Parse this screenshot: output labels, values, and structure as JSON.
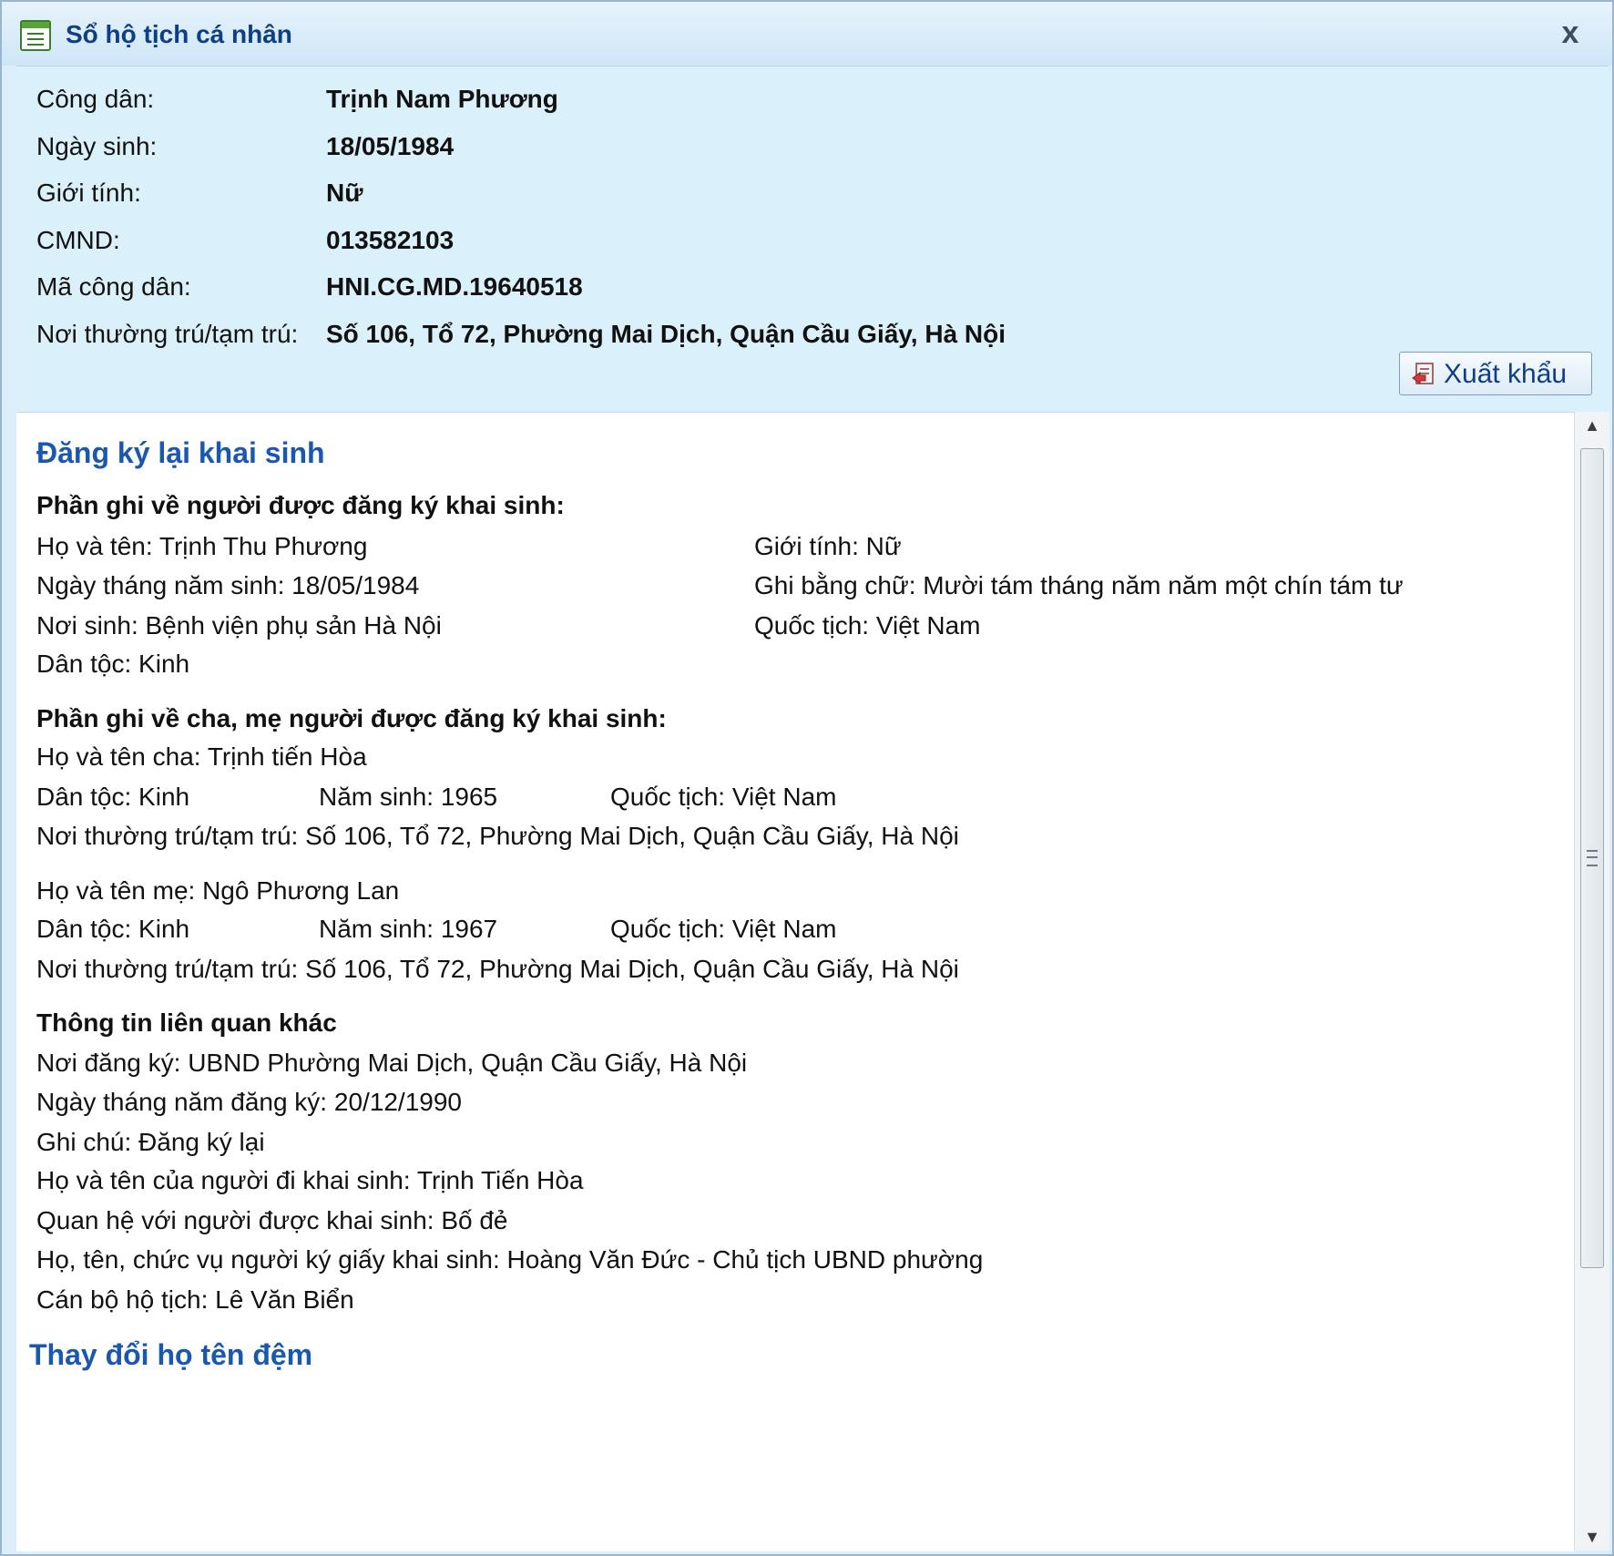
{
  "window": {
    "title": "Sổ hộ tịch cá nhân",
    "close_label": "x"
  },
  "citizen": {
    "fields": [
      {
        "label": "Công dân:",
        "value": "Trịnh Nam Phương"
      },
      {
        "label": "Ngày sinh:",
        "value": "18/05/1984"
      },
      {
        "label": "Giới tính:",
        "value": "Nữ"
      },
      {
        "label": "CMND:",
        "value": "013582103"
      },
      {
        "label": "Mã công dân:",
        "value": "HNI.CG.MD.19640518"
      },
      {
        "label": "Nơi thường trú/tạm trú:",
        "value": "Số 106, Tổ 72, Phường Mai Dịch, Quận Cầu Giấy, Hà Nội"
      }
    ],
    "export_label": "Xuất khẩu"
  },
  "record": {
    "section_title": "Đăng ký lại khai sinh",
    "registrant_heading": "Phần ghi về người được đăng ký khai sinh:",
    "name": "Họ và tên: Trịnh Thu Phương",
    "gender": "Giới tính: Nữ",
    "dob": "Ngày tháng năm sinh: 18/05/1984",
    "dob_words": "Ghi bằng chữ: Mười tám tháng năm năm một chín tám tư",
    "birthplace": "Nơi sinh: Bệnh viện phụ sản Hà Nội",
    "nationality": "Quốc tịch: Việt Nam",
    "ethnicity": "Dân tộc: Kinh",
    "parents_heading": "Phần ghi về cha, mẹ người được đăng ký khai sinh:",
    "father": {
      "name": "Họ và tên cha: Trịnh tiến Hòa",
      "ethnicity": "Dân tộc: Kinh",
      "birth_year": "Năm sinh: 1965",
      "nationality": "Quốc tịch: Việt Nam",
      "residence": "Nơi thường trú/tạm trú: Số 106, Tổ 72, Phường Mai Dịch, Quận Cầu Giấy, Hà Nội"
    },
    "mother": {
      "name": "Họ và tên mẹ: Ngô Phương Lan",
      "ethnicity": "Dân tộc: Kinh",
      "birth_year": "Năm sinh: 1967",
      "nationality": "Quốc tịch: Việt Nam",
      "residence": "Nơi thường trú/tạm trú: Số 106, Tổ 72, Phường Mai Dịch, Quận Cầu Giấy, Hà Nội"
    },
    "other_heading": "Thông tin liên quan khác",
    "other_lines": [
      "Nơi đăng ký: UBND Phường Mai Dịch, Quận Cầu Giấy, Hà Nội",
      "Ngày tháng năm đăng ký: 20/12/1990",
      "Ghi chú: Đăng ký lại",
      "Họ và tên của người đi khai sinh: Trịnh Tiến Hòa",
      "Quan hệ với người được khai sinh: Bố đẻ",
      "Họ, tên, chức vụ người ký giấy khai sinh: Hoàng Văn Đức - Chủ tịch UBND phường",
      "Cán bộ hộ tịch: Lê Văn Biển"
    ],
    "next_section_title": "Thay đổi họ tên đệm"
  }
}
